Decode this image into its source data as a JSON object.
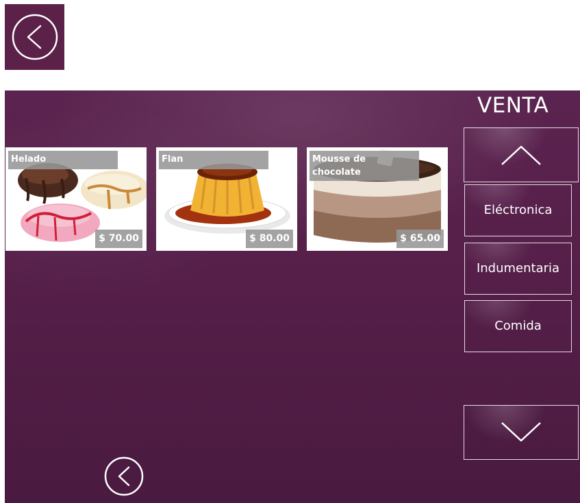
{
  "header": {
    "back_icon": "chevron-left-circle-icon"
  },
  "panel": {
    "title": "VENTA",
    "products": [
      {
        "name": "Helado",
        "price": "$ 70.00",
        "image": "ice-cream-image"
      },
      {
        "name": "Flan",
        "price": "$ 80.00",
        "image": "flan-image"
      },
      {
        "name": "Mousse de chocolate",
        "price": "$ 65.00",
        "image": "chocolate-mousse-image"
      }
    ],
    "categories": [
      {
        "label": "Eléctronica"
      },
      {
        "label": "Indumentaria"
      },
      {
        "label": "Comida"
      }
    ],
    "scroll_up_icon": "chevron-up-icon",
    "scroll_down_icon": "chevron-down-icon",
    "bottom_back_icon": "chevron-left-circle-icon"
  },
  "colors": {
    "brand": "#5b2148",
    "panel_top": "#5b2450",
    "panel_bottom": "#4a1a40",
    "label_bg": "#969696",
    "text": "#ffffff"
  }
}
